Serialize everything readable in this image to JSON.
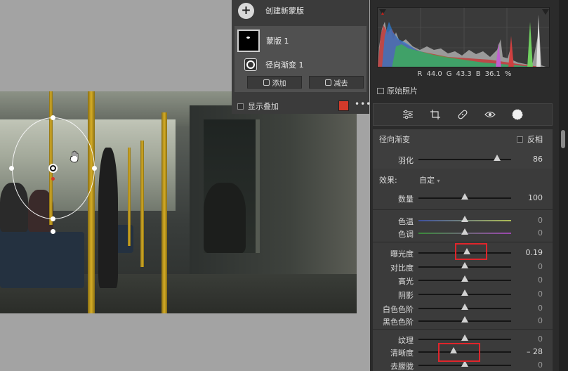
{
  "mask_panel": {
    "create_label": "创建新蒙版",
    "mask_name": "蒙版 1",
    "radial_name": "径向渐变 1",
    "add_label": "添加",
    "subtract_label": "减去",
    "overlay_label": "显示叠加",
    "overlay_color": "#d33a2a"
  },
  "histogram": {
    "r_label": "R",
    "r_value": "44.0",
    "g_label": "G",
    "g_value": "43.3",
    "b_label": "B",
    "b_value": "36.1",
    "unit": "%",
    "original_label": "原始照片"
  },
  "toolbar": {
    "tools": [
      "sliders-icon",
      "crop-icon",
      "healing-bandage-icon",
      "redeye-icon",
      "mask-circle-icon"
    ]
  },
  "radial": {
    "title": "径向渐变",
    "invert_label": "反相",
    "feather_label": "羽化",
    "feather_value": "86"
  },
  "effects": {
    "label": "效果:",
    "preset": "自定",
    "amount_label": "数量",
    "amount_value": "100",
    "sliders": [
      {
        "label": "色温",
        "value": "0"
      },
      {
        "label": "色调",
        "value": "0"
      },
      {
        "label": "曝光度",
        "value": "0.19"
      },
      {
        "label": "对比度",
        "value": "0"
      },
      {
        "label": "高光",
        "value": "0"
      },
      {
        "label": "阴影",
        "value": "0"
      },
      {
        "label": "白色色阶",
        "value": "0"
      },
      {
        "label": "黑色色阶",
        "value": "0"
      },
      {
        "label": "纹理",
        "value": "0"
      },
      {
        "label": "清晰度",
        "value": "– 28"
      },
      {
        "label": "去朦胧",
        "value": "0"
      }
    ]
  }
}
